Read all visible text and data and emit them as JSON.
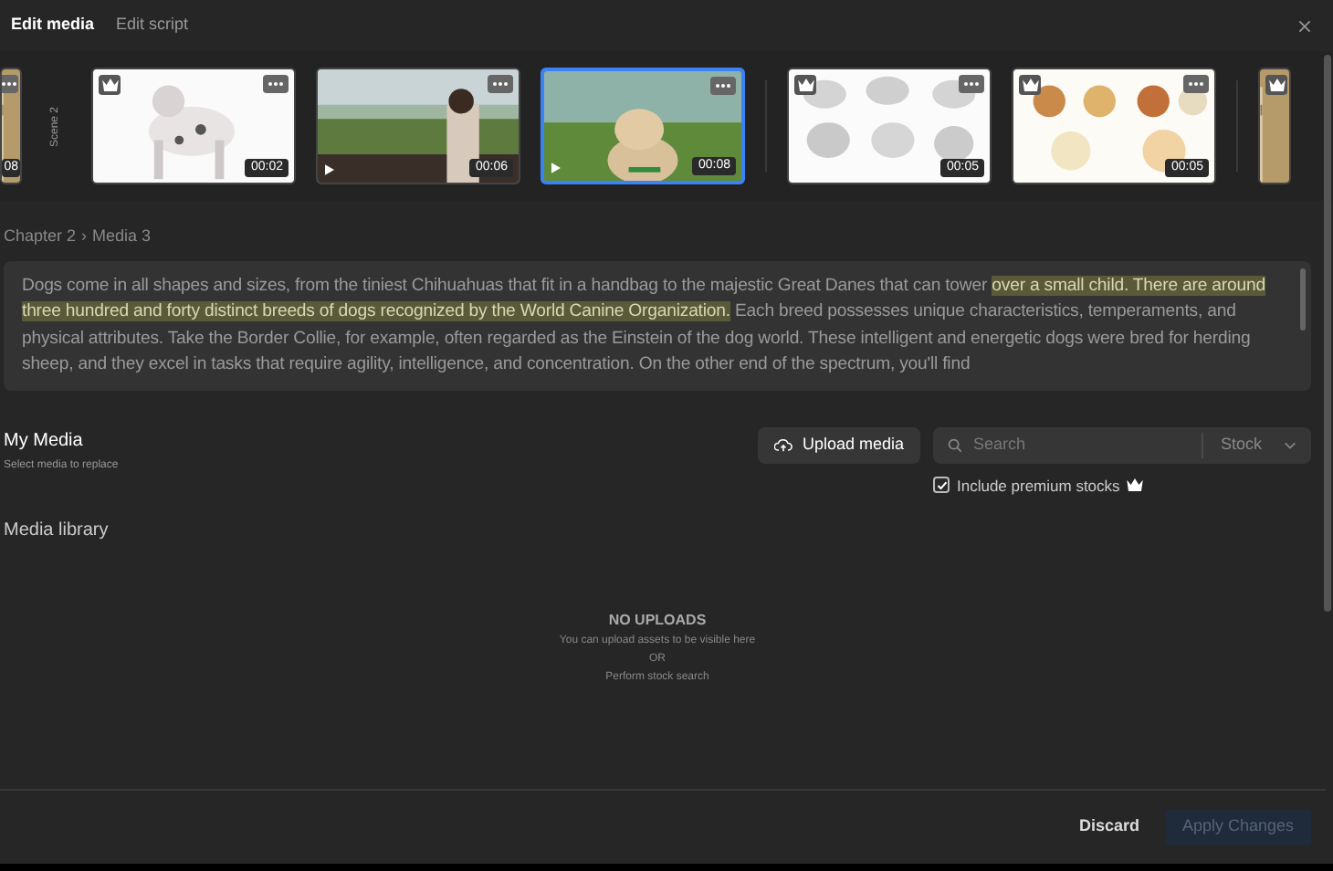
{
  "header": {
    "tabs": [
      {
        "label": "Edit media",
        "selected": true
      },
      {
        "label": "Edit script",
        "selected": false
      }
    ]
  },
  "strip": {
    "scene_label": "Scene 2",
    "thumbnails": [
      {
        "kind": "leading",
        "duration": "08",
        "premium": false,
        "menu": true,
        "play": false,
        "selected": false
      },
      {
        "kind": "full",
        "duration": "00:02",
        "premium": true,
        "menu": true,
        "play": false,
        "selected": false
      },
      {
        "kind": "full",
        "duration": "00:06",
        "premium": false,
        "menu": true,
        "play": true,
        "selected": false
      },
      {
        "kind": "full",
        "duration": "00:08",
        "premium": false,
        "menu": true,
        "play": true,
        "selected": true
      },
      {
        "kind": "full",
        "duration": "00:05",
        "premium": true,
        "menu": true,
        "play": false,
        "selected": false
      },
      {
        "kind": "full",
        "duration": "00:05",
        "premium": true,
        "menu": true,
        "play": false,
        "selected": false
      },
      {
        "kind": "trailing",
        "premium": true,
        "menu": false,
        "play": false,
        "selected": false
      }
    ]
  },
  "breadcrumb": {
    "items": [
      "Chapter 2",
      "Media 3"
    ],
    "separator": "›"
  },
  "script": [
    {
      "text": "Dogs come in all shapes and sizes, from the tiniest Chihuahuas that fit in a handbag to the majestic Great Danes that can tower ",
      "highlighted": false
    },
    {
      "text": "over a small child. There are around three hundred and forty distinct breeds of dogs recognized by the World Canine Organization.",
      "highlighted": true
    },
    {
      "text": " Each breed possesses unique characteristics, temperaments, and physical attributes. Take the Border Collie, for example, often regarded as the Einstein of the dog world. These intelligent and energetic dogs were bred for herding sheep, and they excel in tasks that require agility, intelligence, and concentration. On the other end of the spectrum, you'll find",
      "highlighted": false
    }
  ],
  "my_media": {
    "title": "My Media",
    "subtitle": "Select media to replace",
    "upload_button": "Upload media",
    "search": {
      "placeholder": "Search",
      "source": "Stock"
    },
    "premium_checkbox": {
      "label": "Include premium stocks",
      "checked": true
    }
  },
  "library": {
    "title": "Media library",
    "empty_title": "NO UPLOADS",
    "empty_lines": [
      "You can upload assets to be visible here",
      "OR",
      "Perform stock search"
    ]
  },
  "footer": {
    "discard": "Discard",
    "apply": {
      "label": "Apply Changes",
      "disabled": true
    }
  }
}
